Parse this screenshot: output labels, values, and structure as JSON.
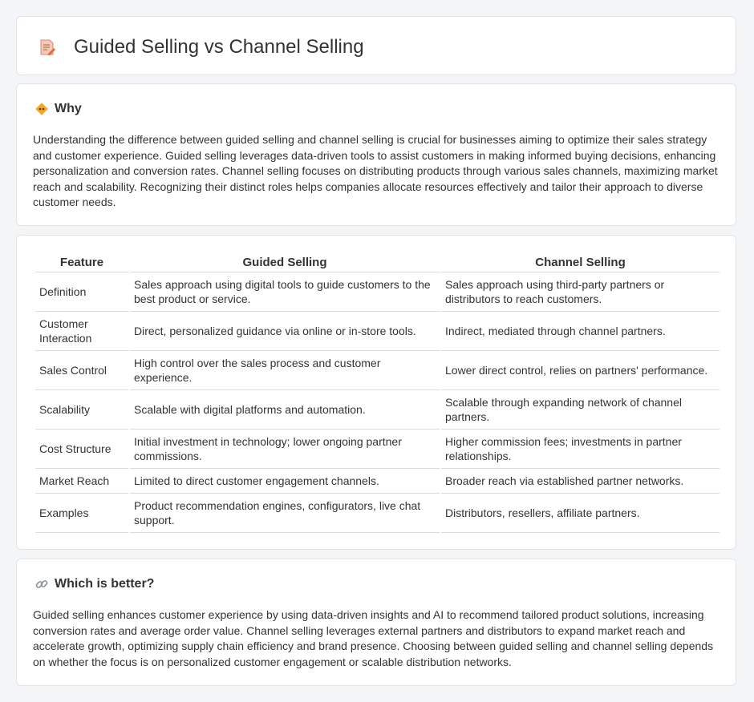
{
  "header": {
    "title": "Guided Selling vs Channel Selling",
    "icon": "document-edit-icon"
  },
  "why": {
    "heading": "Why",
    "icon": "diamond-sign-icon",
    "text": "Understanding the difference between guided selling and channel selling is crucial for businesses aiming to optimize their sales strategy and customer experience. Guided selling leverages data-driven tools to assist customers in making informed buying decisions, enhancing personalization and conversion rates. Channel selling focuses on distributing products through various sales channels, maximizing market reach and scalability. Recognizing their distinct roles helps companies allocate resources effectively and tailor their approach to diverse customer needs."
  },
  "table": {
    "headers": [
      "Feature",
      "Guided Selling",
      "Channel Selling"
    ],
    "rows": [
      [
        "Definition",
        "Sales approach using digital tools to guide customers to the best product or service.",
        "Sales approach using third-party partners or distributors to reach customers."
      ],
      [
        "Customer Interaction",
        "Direct, personalized guidance via online or in-store tools.",
        "Indirect, mediated through channel partners."
      ],
      [
        "Sales Control",
        "High control over the sales process and customer experience.",
        "Lower direct control, relies on partners' performance."
      ],
      [
        "Scalability",
        "Scalable with digital platforms and automation.",
        "Scalable through expanding network of channel partners."
      ],
      [
        "Cost Structure",
        "Initial investment in technology; lower ongoing partner commissions.",
        "Higher commission fees; investments in partner relationships."
      ],
      [
        "Market Reach",
        "Limited to direct customer engagement channels.",
        "Broader reach via established partner networks."
      ],
      [
        "Examples",
        "Product recommendation engines, configurators, live chat support.",
        "Distributors, resellers, affiliate partners."
      ]
    ]
  },
  "better": {
    "heading": "Which is better?",
    "icon": "link-icon",
    "text": "Guided selling enhances customer experience by using data-driven insights and AI to recommend tailored product solutions, increasing conversion rates and average order value. Channel selling leverages external partners and distributors to expand market reach and accelerate growth, optimizing supply chain efficiency and brand presence. Choosing between guided selling and channel selling depends on whether the focus is on personalized customer engagement or scalable distribution networks."
  }
}
